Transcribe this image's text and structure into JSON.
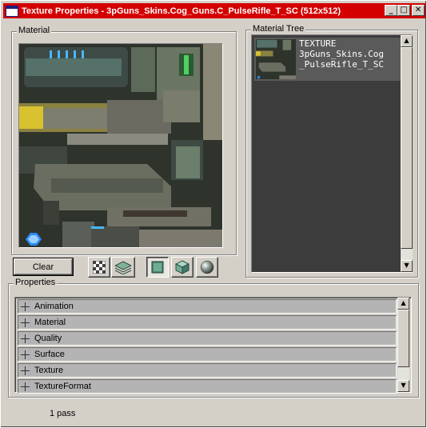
{
  "window": {
    "title": "Texture Properties - 3pGuns_Skins.Cog_Guns.C_PulseRifle_T_SC (512x512)",
    "controls": [
      "minimize-icon",
      "maximize-icon",
      "close-icon"
    ]
  },
  "material": {
    "label": "Material"
  },
  "toolbar": {
    "clear_label": "Clear",
    "icons": [
      "checker-background-icon",
      "layers-icon",
      "flat-plane-icon",
      "cube-icon",
      "sphere-icon"
    ]
  },
  "material_tree": {
    "label": "Material Tree",
    "items": [
      {
        "lines": [
          "TEXTURE",
          "3pGuns_Skins.Cog",
          "_PulseRifle_T_SC"
        ]
      }
    ]
  },
  "properties": {
    "label": "Properties",
    "groups": [
      "Animation",
      "Material",
      "Quality",
      "Surface",
      "Texture",
      "TextureFormat"
    ]
  },
  "status": {
    "text": "1 pass"
  },
  "colors": {
    "titlebar": "#d40000",
    "face": "#d4d0c8",
    "tree_bg": "#3c3c3c",
    "tree_item": "#5a5a5a",
    "prop_row": "#b4b4b4"
  }
}
